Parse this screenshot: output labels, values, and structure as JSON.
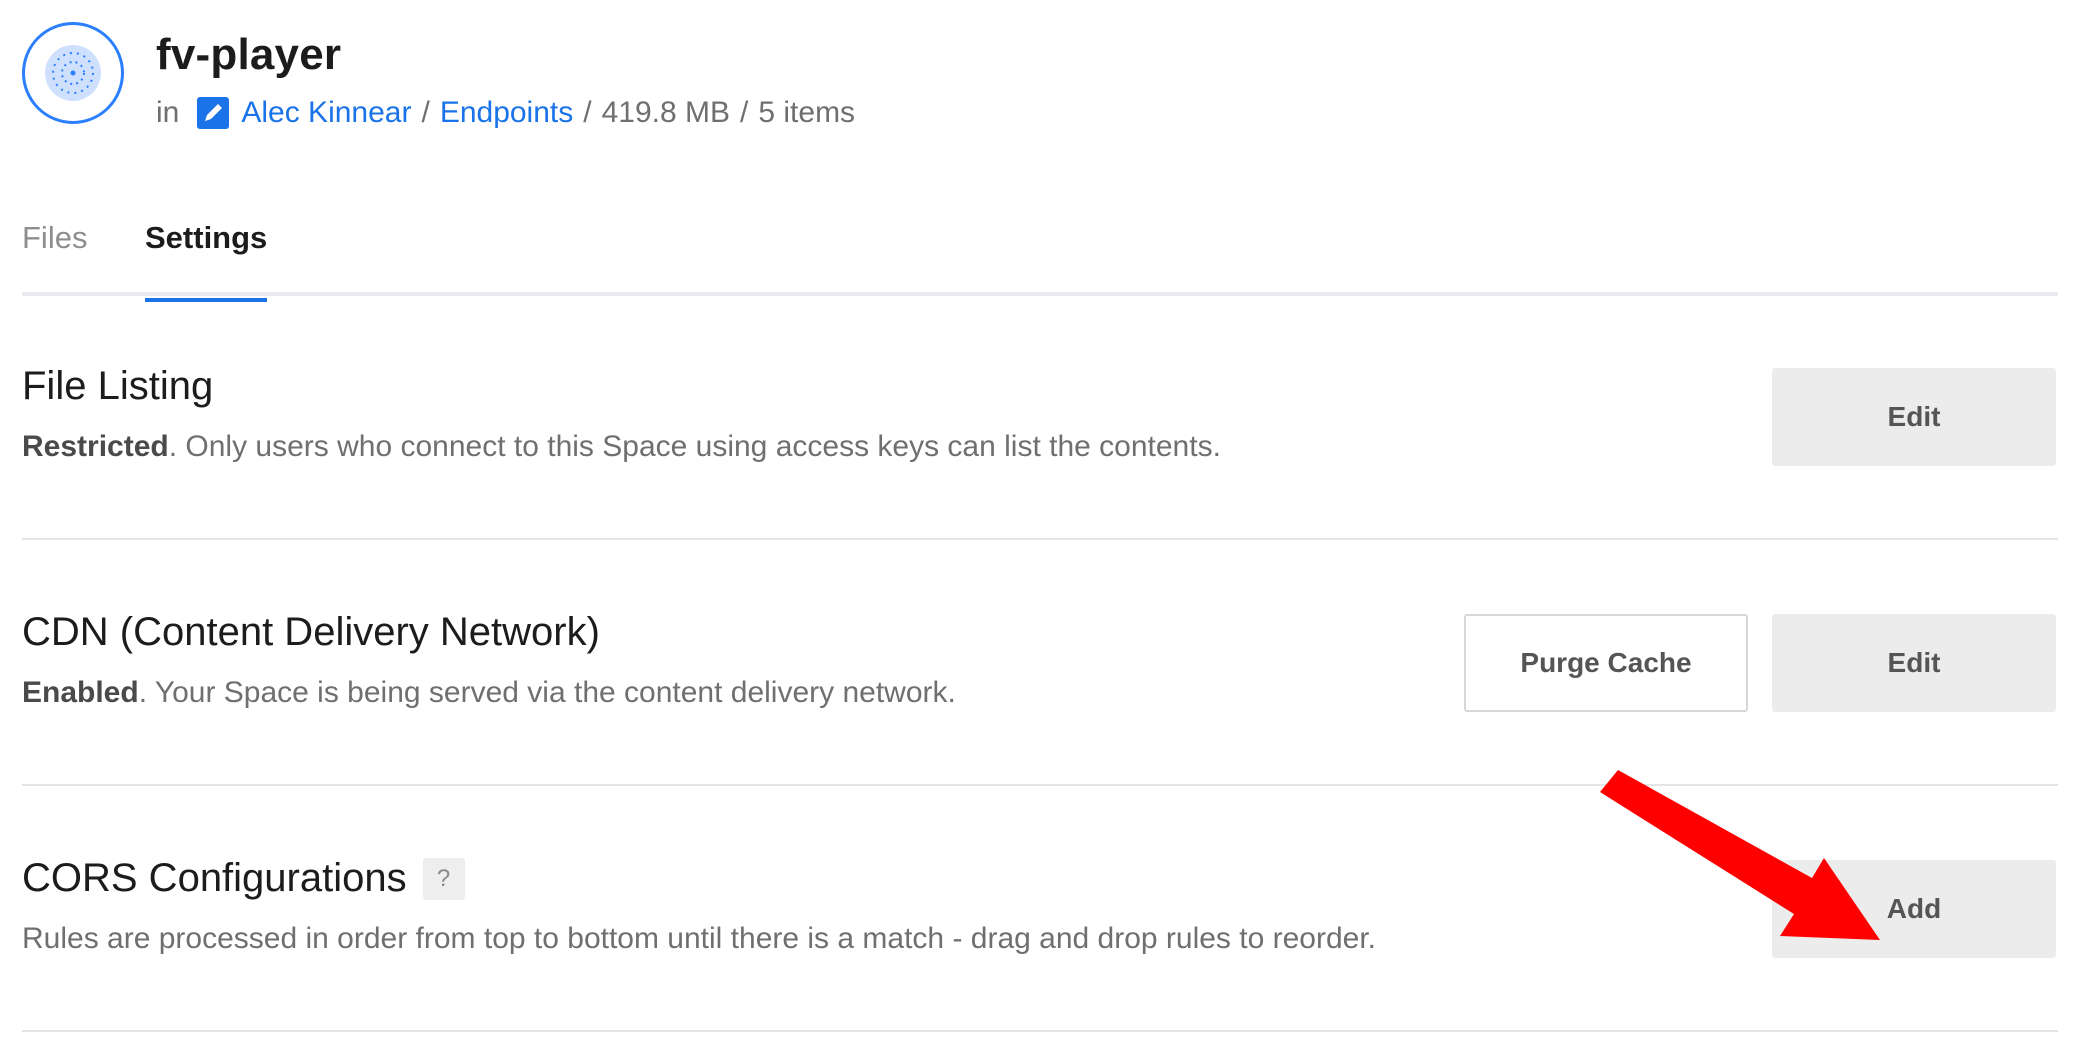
{
  "header": {
    "space_icon": "space-globe-icon",
    "title": "fv-player",
    "in_label": "in",
    "team_icon": "team-pencil-icon",
    "breadcrumb": {
      "team": "Alec Kinnear",
      "project": "Endpoints",
      "size": "419.8 MB",
      "items": "5 items",
      "separator": "/"
    },
    "accent_color": "#1a73e8"
  },
  "tabs": [
    {
      "label": "Files",
      "active": false
    },
    {
      "label": "Settings",
      "active": true
    }
  ],
  "sections": {
    "file_listing": {
      "title": "File Listing",
      "status": "Restricted",
      "description": ". Only users who connect to this Space using access keys can list the contents.",
      "edit_label": "Edit"
    },
    "cdn": {
      "title": "CDN (Content Delivery Network)",
      "status": "Enabled",
      "description": ". Your Space is being served via the content delivery network.",
      "purge_label": "Purge Cache",
      "edit_label": "Edit"
    },
    "cors": {
      "title": "CORS Configurations",
      "help_label": "?",
      "description": "Rules are processed in order from top to bottom until there is a match - drag and drop rules to reorder.",
      "add_label": "Add"
    }
  },
  "annotation": {
    "arrow_icon": "red-arrow-icon",
    "arrow_color": "#ff0000"
  }
}
